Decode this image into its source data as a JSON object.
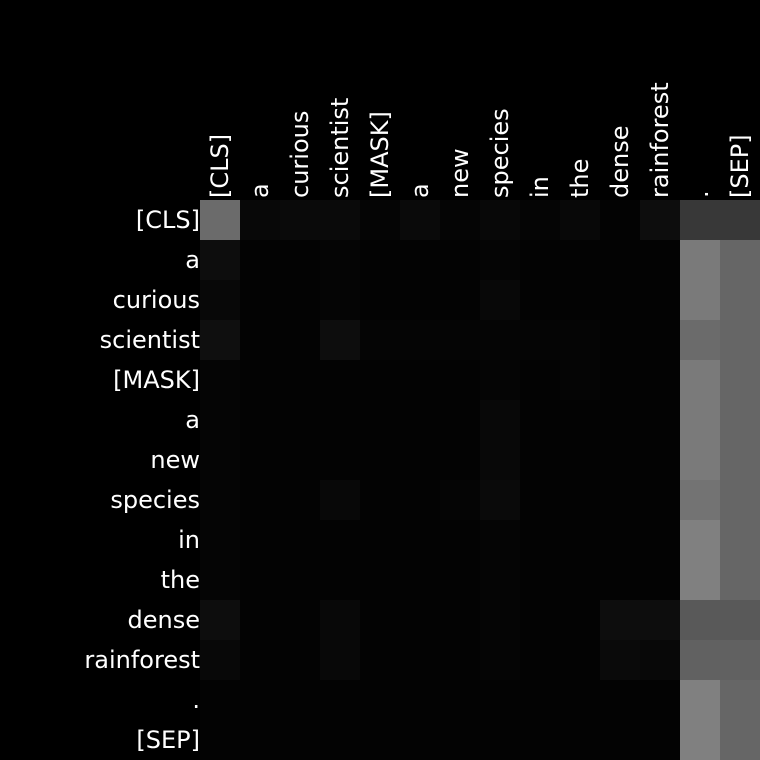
{
  "chart_data": {
    "type": "heatmap",
    "colormap": "grayscale",
    "x_labels": [
      "[CLS]",
      "a",
      "curious",
      "scientist",
      "[MASK]",
      "a",
      "new",
      "species",
      "in",
      "the",
      "dense",
      "rainforest",
      ".",
      "[SEP]"
    ],
    "y_labels": [
      "[CLS]",
      "a",
      "curious",
      "scientist",
      "[MASK]",
      "a",
      "new",
      "species",
      "in",
      "the",
      "dense",
      "rainforest",
      ".",
      "[SEP]"
    ],
    "value_range": [
      0,
      1
    ],
    "values": [
      [
        0.42,
        0.03,
        0.04,
        0.04,
        0.02,
        0.04,
        0.02,
        0.03,
        0.02,
        0.03,
        0.01,
        0.05,
        0.22,
        0.22
      ],
      [
        0.05,
        0.01,
        0.01,
        0.02,
        0.01,
        0.01,
        0.01,
        0.02,
        0.01,
        0.01,
        0.01,
        0.01,
        0.48,
        0.4
      ],
      [
        0.03,
        0.01,
        0.01,
        0.02,
        0.01,
        0.01,
        0.01,
        0.03,
        0.01,
        0.01,
        0.01,
        0.01,
        0.48,
        0.4
      ],
      [
        0.06,
        0.01,
        0.01,
        0.05,
        0.02,
        0.02,
        0.02,
        0.02,
        0.02,
        0.02,
        0.01,
        0.01,
        0.42,
        0.4
      ],
      [
        0.02,
        0.01,
        0.01,
        0.01,
        0.01,
        0.01,
        0.01,
        0.02,
        0.01,
        0.02,
        0.01,
        0.01,
        0.48,
        0.4
      ],
      [
        0.02,
        0.01,
        0.01,
        0.01,
        0.01,
        0.01,
        0.01,
        0.03,
        0.01,
        0.01,
        0.01,
        0.01,
        0.48,
        0.4
      ],
      [
        0.02,
        0.01,
        0.01,
        0.01,
        0.01,
        0.01,
        0.01,
        0.03,
        0.01,
        0.01,
        0.01,
        0.01,
        0.48,
        0.4
      ],
      [
        0.02,
        0.01,
        0.01,
        0.03,
        0.01,
        0.01,
        0.02,
        0.04,
        0.01,
        0.01,
        0.01,
        0.01,
        0.45,
        0.4
      ],
      [
        0.02,
        0.01,
        0.01,
        0.01,
        0.01,
        0.01,
        0.01,
        0.02,
        0.01,
        0.01,
        0.01,
        0.01,
        0.5,
        0.4
      ],
      [
        0.02,
        0.01,
        0.01,
        0.01,
        0.01,
        0.01,
        0.01,
        0.02,
        0.01,
        0.01,
        0.01,
        0.01,
        0.5,
        0.4
      ],
      [
        0.05,
        0.01,
        0.01,
        0.03,
        0.01,
        0.01,
        0.01,
        0.02,
        0.01,
        0.01,
        0.05,
        0.05,
        0.35,
        0.35
      ],
      [
        0.03,
        0.01,
        0.01,
        0.03,
        0.01,
        0.01,
        0.01,
        0.02,
        0.01,
        0.01,
        0.04,
        0.03,
        0.38,
        0.38
      ],
      [
        0.01,
        0.01,
        0.01,
        0.01,
        0.01,
        0.01,
        0.01,
        0.01,
        0.01,
        0.01,
        0.01,
        0.01,
        0.5,
        0.4
      ],
      [
        0.01,
        0.01,
        0.01,
        0.01,
        0.01,
        0.01,
        0.01,
        0.01,
        0.01,
        0.01,
        0.01,
        0.01,
        0.5,
        0.4
      ]
    ]
  }
}
